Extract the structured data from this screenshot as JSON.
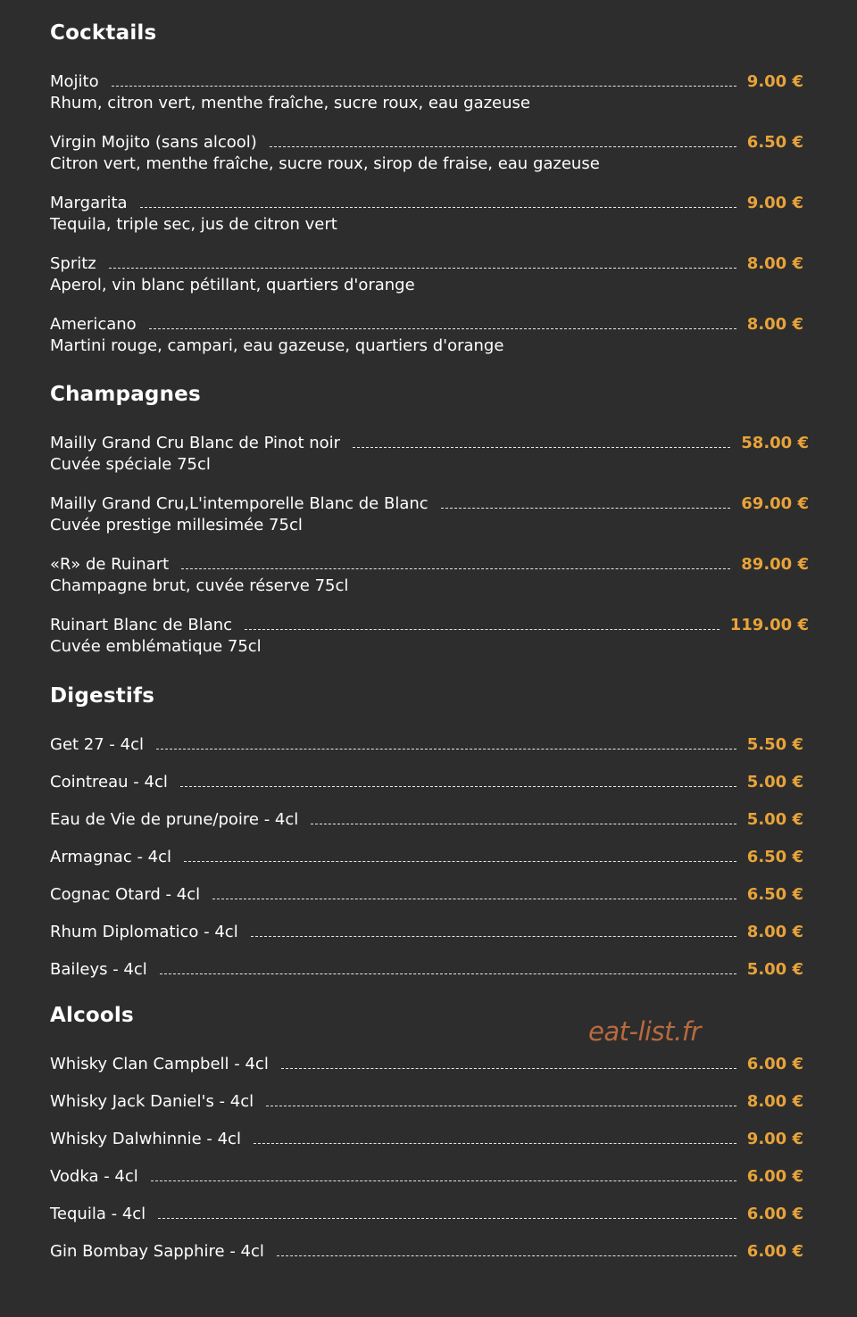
{
  "colors": {
    "background": "#2d2d2d",
    "text": "#ffffff",
    "price": "#e8a33a",
    "watermark": "#b86a3e"
  },
  "watermark": "eat-list.fr",
  "sections": [
    {
      "title": "Cocktails",
      "items": [
        {
          "name": "Mojito",
          "price": "9.00 €",
          "desc": "Rhum, citron vert, menthe fraîche, sucre roux, eau gazeuse"
        },
        {
          "name": "Virgin Mojito (sans alcool)",
          "price": "6.50 €",
          "desc": "Citron vert, menthe fraîche, sucre roux, sirop de fraise, eau gazeuse"
        },
        {
          "name": "Margarita",
          "price": "9.00 €",
          "desc": "Tequila, triple sec, jus de citron vert"
        },
        {
          "name": "Spritz",
          "price": "8.00 €",
          "desc": "Aperol, vin blanc pétillant, quartiers d'orange"
        },
        {
          "name": "Americano",
          "price": "8.00 €",
          "desc": "Martini rouge, campari, eau gazeuse, quartiers d'orange"
        }
      ]
    },
    {
      "title": "Champagnes",
      "items": [
        {
          "name": "Mailly Grand Cru Blanc de Pinot noir",
          "price": "58.00 €",
          "desc": "Cuvée spéciale 75cl"
        },
        {
          "name": "Mailly Grand Cru,L'intemporelle Blanc de Blanc",
          "price": "69.00 €",
          "desc": "Cuvée prestige millesimée 75cl"
        },
        {
          "name": "«R» de Ruinart",
          "price": "89.00 €",
          "desc": "Champagne brut, cuvée réserve 75cl"
        },
        {
          "name": "Ruinart Blanc de Blanc",
          "price": "119.00 €",
          "desc": "Cuvée emblématique 75cl"
        }
      ]
    },
    {
      "title": "Digestifs",
      "items": [
        {
          "name": "Get 27 - 4cl",
          "price": "5.50 €"
        },
        {
          "name": "Cointreau - 4cl",
          "price": "5.00 €"
        },
        {
          "name": "Eau de Vie de prune/poire - 4cl",
          "price": "5.00 €"
        },
        {
          "name": "Armagnac - 4cl",
          "price": "6.50 €"
        },
        {
          "name": "Cognac Otard - 4cl",
          "price": "6.50 €"
        },
        {
          "name": "Rhum Diplomatico - 4cl",
          "price": "8.00 €"
        },
        {
          "name": "Baileys - 4cl",
          "price": "5.00 €"
        }
      ]
    },
    {
      "title": "Alcools",
      "items": [
        {
          "name": "Whisky Clan Campbell - 4cl",
          "price": "6.00 €"
        },
        {
          "name": "Whisky Jack Daniel's - 4cl",
          "price": "8.00 €"
        },
        {
          "name": "Whisky Dalwhinnie - 4cl",
          "price": "9.00 €"
        },
        {
          "name": "Vodka - 4cl",
          "price": "6.00 €"
        },
        {
          "name": "Tequila - 4cl",
          "price": "6.00 €"
        },
        {
          "name": "Gin Bombay Sapphire - 4cl",
          "price": "6.00 €"
        }
      ]
    }
  ]
}
